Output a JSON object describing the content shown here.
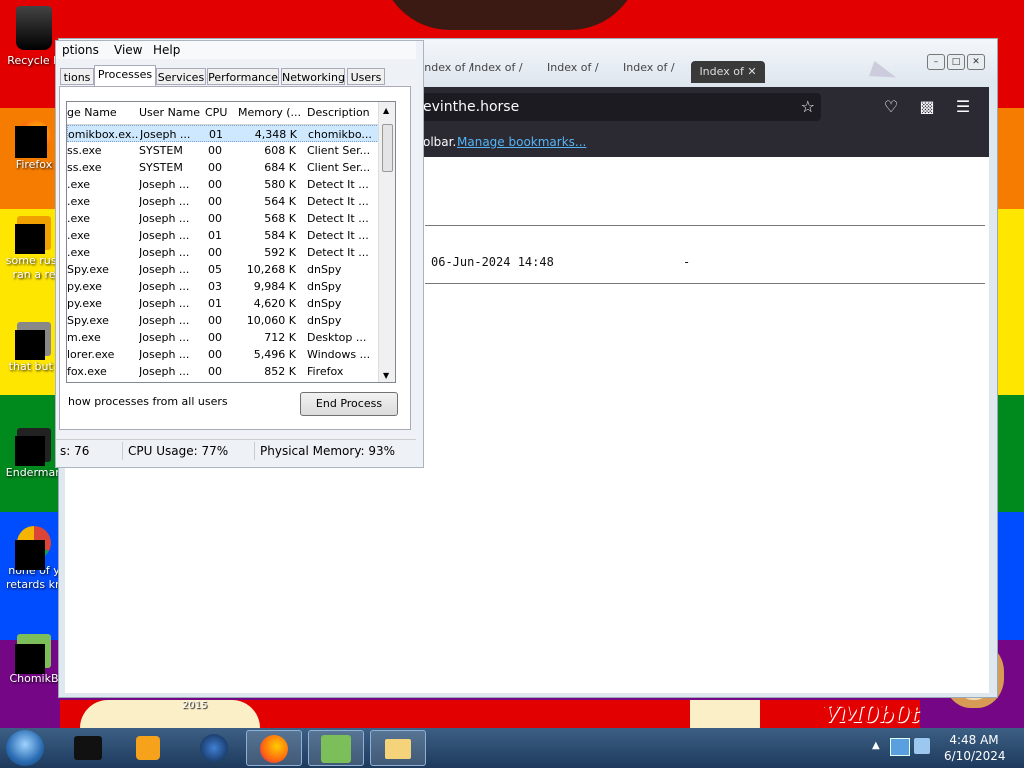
{
  "desktop": {
    "stripe_colors": [
      "#e20001",
      "#f57c00",
      "#ffe600",
      "#008a1e",
      "#004cff",
      "#750787"
    ],
    "icons": [
      {
        "label": "Recycle B",
        "icon": "recycle-bin-icon"
      },
      {
        "label": "Firefox",
        "icon": "firefox-icon"
      },
      {
        "label": "some russ ran a re",
        "icon": "file-icon"
      },
      {
        "label": "that but i",
        "icon": "folder-icon"
      },
      {
        "label": "Enderman",
        "icon": "app-icon"
      },
      {
        "label": "none of y retards kn",
        "icon": "chrome-icon"
      },
      {
        "label": "ChomikB",
        "icon": "chomik-icon"
      }
    ],
    "watermark": "VM0b0t",
    "partial_label": "2015"
  },
  "browser": {
    "tabs": [
      "Index of /",
      "Index of /",
      "Index of /",
      "Index of /"
    ],
    "active_tab": "Index of ✕",
    "url": "evinthe.horse",
    "bookmarks_text": "olbar.",
    "bookmarks_link": "Manage bookmarks...",
    "listing": {
      "date": "06-Jun-2024 14:48",
      "size": "-"
    }
  },
  "task_manager": {
    "menu": [
      "ptions",
      "View",
      "Help"
    ],
    "tabs": [
      "tions",
      "Processes",
      "Services",
      "Performance",
      "Networking",
      "Users"
    ],
    "columns": [
      "ge Name",
      "User Name",
      "CPU",
      "Memory (...",
      "Description"
    ],
    "rows": [
      {
        "name": "omikbox.ex...",
        "user": "Joseph ...",
        "cpu": "01",
        "mem": "4,348 K",
        "desc": "chomikbo..."
      },
      {
        "name": "ss.exe",
        "user": "SYSTEM",
        "cpu": "00",
        "mem": "608 K",
        "desc": "Client Ser..."
      },
      {
        "name": "ss.exe",
        "user": "SYSTEM",
        "cpu": "00",
        "mem": "684 K",
        "desc": "Client Ser..."
      },
      {
        "name": ".exe",
        "user": "Joseph ...",
        "cpu": "00",
        "mem": "580 K",
        "desc": "Detect It ..."
      },
      {
        "name": ".exe",
        "user": "Joseph ...",
        "cpu": "00",
        "mem": "564 K",
        "desc": "Detect It ..."
      },
      {
        "name": ".exe",
        "user": "Joseph ...",
        "cpu": "00",
        "mem": "568 K",
        "desc": "Detect It ..."
      },
      {
        "name": ".exe",
        "user": "Joseph ...",
        "cpu": "01",
        "mem": "584 K",
        "desc": "Detect It ..."
      },
      {
        "name": ".exe",
        "user": "Joseph ...",
        "cpu": "00",
        "mem": "592 K",
        "desc": "Detect It ..."
      },
      {
        "name": "Spy.exe",
        "user": "Joseph ...",
        "cpu": "05",
        "mem": "10,268 K",
        "desc": "dnSpy"
      },
      {
        "name": "py.exe",
        "user": "Joseph ...",
        "cpu": "03",
        "mem": "9,984 K",
        "desc": "dnSpy"
      },
      {
        "name": "py.exe",
        "user": "Joseph ...",
        "cpu": "01",
        "mem": "4,620 K",
        "desc": "dnSpy"
      },
      {
        "name": "Spy.exe",
        "user": "Joseph ...",
        "cpu": "00",
        "mem": "10,060 K",
        "desc": "dnSpy"
      },
      {
        "name": "m.exe",
        "user": "Joseph ...",
        "cpu": "00",
        "mem": "712 K",
        "desc": "Desktop ..."
      },
      {
        "name": "lorer.exe",
        "user": "Joseph ...",
        "cpu": "00",
        "mem": "5,496 K",
        "desc": "Windows ..."
      },
      {
        "name": "fox.exe",
        "user": "Joseph ...",
        "cpu": "00",
        "mem": "852 K",
        "desc": "Firefox"
      }
    ],
    "show_all_label": "how processes from all users",
    "end_process_label": "End Process",
    "status": {
      "processes": "s: 76",
      "cpu": "CPU Usage: 77%",
      "memory": "Physical Memory: 93%"
    }
  },
  "taskbar": {
    "items": [
      "start-orb-icon",
      "app-icon",
      "media-player-icon",
      "network-icon",
      "firefox-icon",
      "chomikbox-icon",
      "explorer-icon"
    ],
    "clock_time": "4:48 AM",
    "clock_date": "6/10/2024"
  }
}
